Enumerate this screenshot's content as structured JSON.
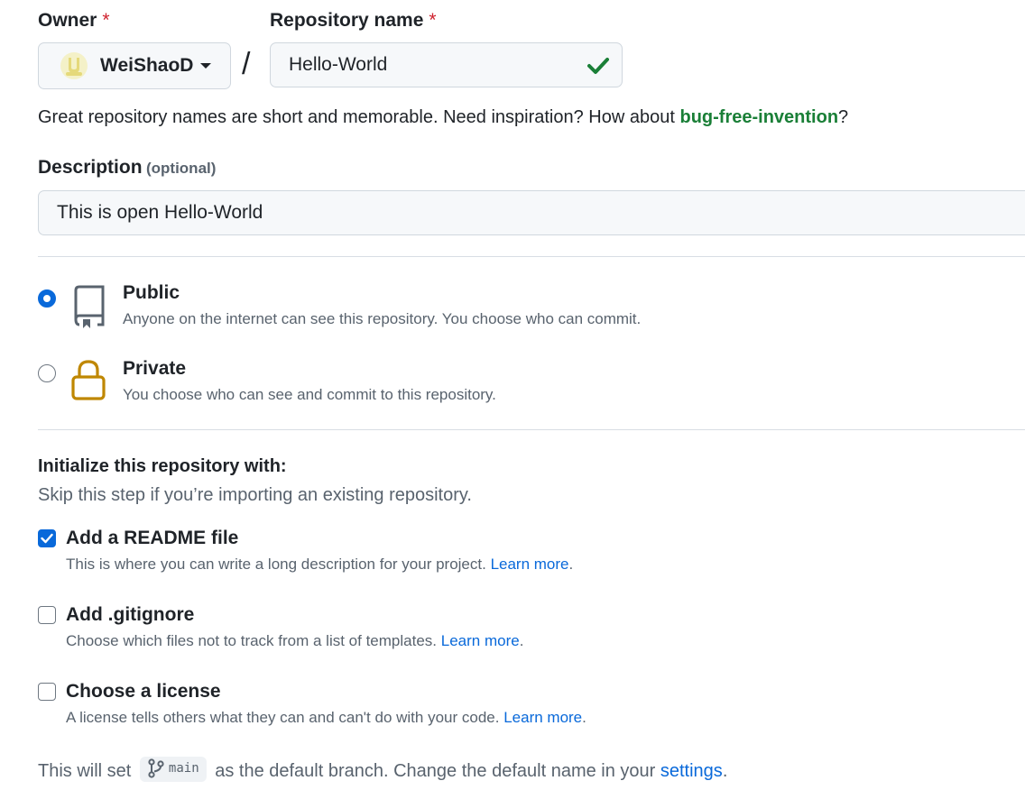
{
  "owner": {
    "label": "Owner",
    "required_mark": "*",
    "selected": "WeiShaoD"
  },
  "repo_name": {
    "label": "Repository name",
    "required_mark": "*",
    "value": "Hello-World",
    "valid": true
  },
  "separator": "/",
  "name_hint": {
    "prefix": "Great repository names are short and memorable. Need inspiration? How about ",
    "suggestion": "bug-free-invention",
    "suffix": "?"
  },
  "description": {
    "label": "Description",
    "optional": "(optional)",
    "value": "This is open Hello-World"
  },
  "visibility": {
    "selected": "public",
    "options": [
      {
        "id": "public",
        "title": "Public",
        "desc": "Anyone on the internet can see this repository. You choose who can commit.",
        "icon": "repo-icon"
      },
      {
        "id": "private",
        "title": "Private",
        "desc": "You choose who can see and commit to this repository.",
        "icon": "lock-icon"
      }
    ]
  },
  "initialize": {
    "title": "Initialize this repository with:",
    "subtitle": "Skip this step if you’re importing an existing repository.",
    "items": [
      {
        "title": "Add a README file",
        "desc": "This is where you can write a long description for your project.",
        "link": "Learn more",
        "after": ".",
        "checked": true
      },
      {
        "title": "Add .gitignore",
        "desc": "Choose which files not to track from a list of templates.",
        "link": "Learn more",
        "after": ".",
        "checked": false
      },
      {
        "title": "Choose a license",
        "desc": "A license tells others what they can and can't do with your code.",
        "link": "Learn more",
        "after": ".",
        "checked": false
      }
    ]
  },
  "default_branch": {
    "prefix": "This will set",
    "branch": "main",
    "middle": "as the default branch. Change the default name in your",
    "link": "settings",
    "suffix": "."
  },
  "colors": {
    "accent": "#0969da",
    "success": "#1a7f37",
    "danger": "#cf222e",
    "private_icon": "#bf8700"
  }
}
